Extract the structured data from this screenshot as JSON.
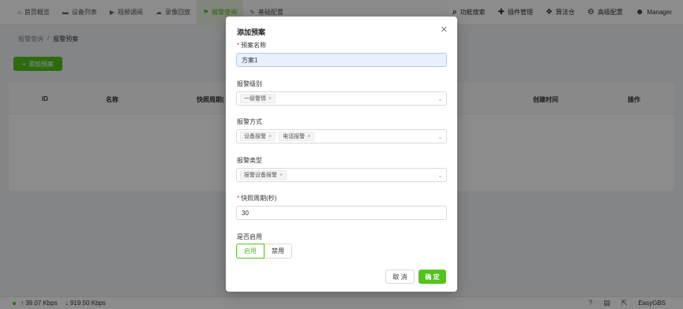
{
  "nav": {
    "items": [
      {
        "label": "首页概览",
        "icon": "home-icon",
        "glyph": "⌂"
      },
      {
        "label": "设备列表",
        "icon": "device-icon",
        "glyph": "▬"
      },
      {
        "label": "视频调阅",
        "icon": "play-icon",
        "glyph": "▶"
      },
      {
        "label": "录像回放",
        "icon": "cloud-icon",
        "glyph": "☁"
      },
      {
        "label": "报警查询",
        "icon": "alarm-icon",
        "glyph": "⚑"
      },
      {
        "label": "基础配置",
        "icon": "edit-icon",
        "glyph": "✎"
      }
    ],
    "right_items": [
      {
        "label": "功能搜索",
        "icon": "search-icon",
        "glyph": "⌕"
      },
      {
        "label": "插件管理",
        "icon": "puzzle-icon",
        "glyph": "✚"
      },
      {
        "label": "算法仓",
        "icon": "algorithm-icon",
        "glyph": "❖"
      },
      {
        "label": "高级配置",
        "icon": "gear-icon",
        "glyph": "⚙"
      },
      {
        "label": "Manager",
        "icon": "user-icon",
        "glyph": "☻"
      }
    ]
  },
  "breadcrumb": {
    "parent": "报警查询",
    "separator": "/",
    "current": "报警预案"
  },
  "add_button": {
    "label": "添加预案",
    "glyph": "+"
  },
  "table": {
    "columns": [
      "ID",
      "名称",
      "快照周期(",
      "创建时间",
      "操作"
    ]
  },
  "modal": {
    "title": "添加预案",
    "close_glyph": "✕",
    "fields": {
      "name": {
        "label": "预案名称",
        "required": "*",
        "value": "方案1"
      },
      "level": {
        "label": "报警级别",
        "tags": [
          "一级警情"
        ]
      },
      "method": {
        "label": "报警方式",
        "tags": [
          "设备报警",
          "电话报警"
        ]
      },
      "type": {
        "label": "报警类型",
        "tags": [
          "报警设备报警"
        ]
      },
      "period": {
        "label": "快照周期(秒)",
        "required": "*",
        "value": "30"
      },
      "enabled": {
        "label": "是否启用",
        "options": [
          "启用",
          "禁用"
        ],
        "selected": "启用"
      }
    },
    "cancel_label": "取 消",
    "ok_label": "确 定"
  },
  "statusbar": {
    "upload": "↑ 39.07 Kbps",
    "download": "↓ 919.50 Kbps",
    "brand": "EasyGBS",
    "icons": {
      "help": "?",
      "doc": "▤",
      "export": "⇱"
    }
  },
  "colors": {
    "accent": "#52c41a",
    "active_bg": "#e9f5df"
  },
  "tag_close": "×",
  "chevron": "⌄"
}
